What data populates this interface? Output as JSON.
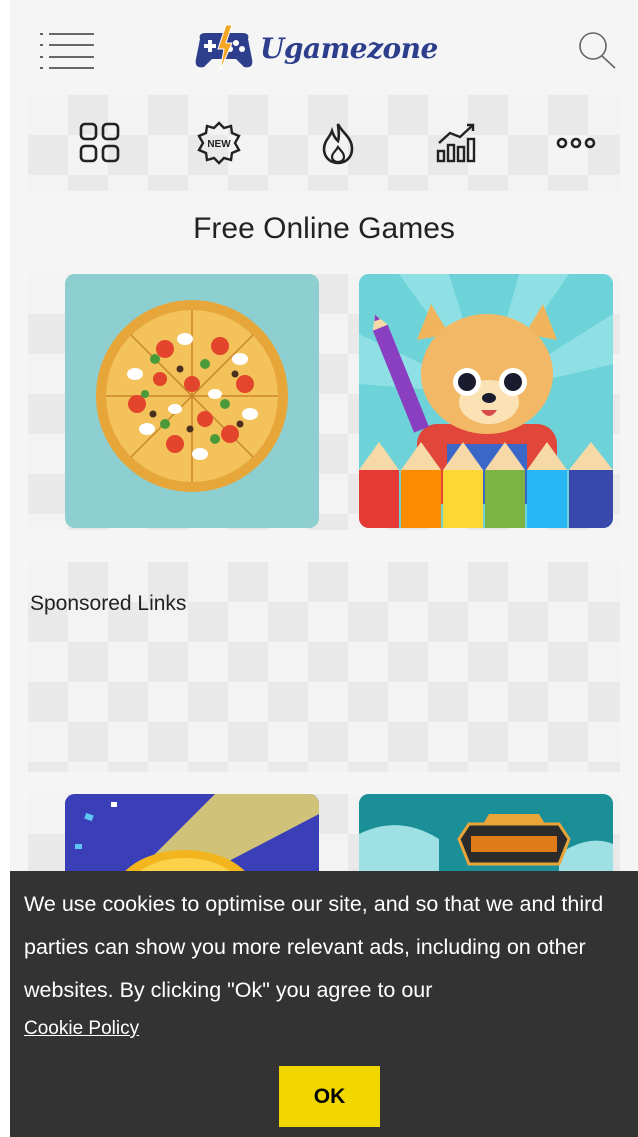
{
  "header": {
    "logo_text": "Ugamezone",
    "menu_icon": "hamburger-menu-icon",
    "search_icon": "search-icon"
  },
  "nav": {
    "items": [
      {
        "name": "all-games",
        "icon": "grid-icon"
      },
      {
        "name": "new-games",
        "icon": "new-badge-icon"
      },
      {
        "name": "hot-games",
        "icon": "flame-icon"
      },
      {
        "name": "top-games",
        "icon": "chart-icon"
      },
      {
        "name": "more",
        "icon": "more-dots-icon"
      }
    ]
  },
  "main": {
    "title": "Free Online Games",
    "games": [
      {
        "name": "pizza-game",
        "thumbnail": "pizza"
      },
      {
        "name": "coloring-game",
        "thumbnail": "puppy-with-pencils"
      }
    ],
    "games_row2": [
      {
        "name": "ball-game",
        "thumbnail": "golden-ball"
      },
      {
        "name": "racing-game",
        "thumbnail": "racing-badge"
      }
    ]
  },
  "sponsored": {
    "label": "Sponsored Links"
  },
  "cookie_banner": {
    "message": "We use cookies to optimise our site, and so that we and third parties can show you more relevant ads, including on other websites. By clicking \"Ok\" you agree to our",
    "policy_link": "Cookie Policy",
    "ok_label": "OK"
  },
  "colors": {
    "brand": "#2c3e8c",
    "cookie_bg": "#333333",
    "ok_button": "#f1d600",
    "page_bg": "#f5f5f5"
  }
}
